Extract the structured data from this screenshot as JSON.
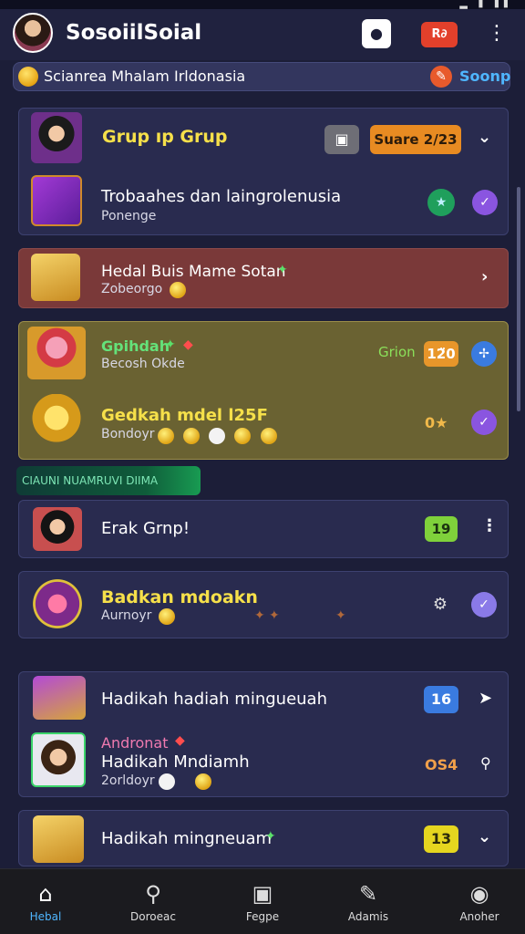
{
  "header": {
    "title": "SosoiilSoial",
    "btn_badge": "R∂",
    "menu_icon": "⋮"
  },
  "location": {
    "text": "Scianrea  Mhalam  Irldonasia",
    "action": "Soonp"
  },
  "card1": {
    "row1": {
      "title": "Grup ıp Grup",
      "badge": "Suare 2/23"
    },
    "row2": {
      "title": "Trobaahes dan laingrolenusia",
      "sub": "Ponenge"
    }
  },
  "card2": {
    "title": "Hedal Buis Mame Sotan",
    "sub": "Zobeorgo"
  },
  "card3": {
    "row1": {
      "title": "Gpihdah",
      "sub": "Becosh Okde",
      "tag": "Grion",
      "badge": "12̈0"
    },
    "row2": {
      "title": "Gedkah mdel l25F",
      "sub": "Bondoyr",
      "badge": "0★"
    }
  },
  "section_label": "CIAUNI NUAMRUVI DIIMA",
  "card4": {
    "title": "Erak Grnp!",
    "badge": "19"
  },
  "card5": {
    "title": "Badkan mdoakn",
    "sub": "Aurnoyr"
  },
  "card6": {
    "row1": {
      "title": "Hadikah hadiah mingueuah",
      "badge": "16"
    },
    "row2": {
      "pretitle": "Andronat",
      "title": "Hadikah Mndiamh",
      "sub": "2orldoyr",
      "badge": "OS4"
    }
  },
  "card7": {
    "title": "Hadikah mingneuam",
    "badge": "13"
  },
  "nav": {
    "items": [
      {
        "label": "Hebal",
        "icon": "home-icon"
      },
      {
        "label": "Doroeac",
        "icon": "search-icon"
      },
      {
        "label": "Fegpe",
        "icon": "grid-icon"
      },
      {
        "label": "Adamis",
        "icon": "edit-icon"
      },
      {
        "label": "Anoher",
        "icon": "profile-icon"
      }
    ]
  },
  "colors": {
    "background": "#1c1e38",
    "card": "#292b4f",
    "highlight_red": "#7c3a3a",
    "highlight_gold": "#6a6232",
    "accent_orange": "#e88b22",
    "accent_green": "#7fd13b",
    "accent_blue": "#3a7be0",
    "accent_yellow": "#e5d61f"
  }
}
